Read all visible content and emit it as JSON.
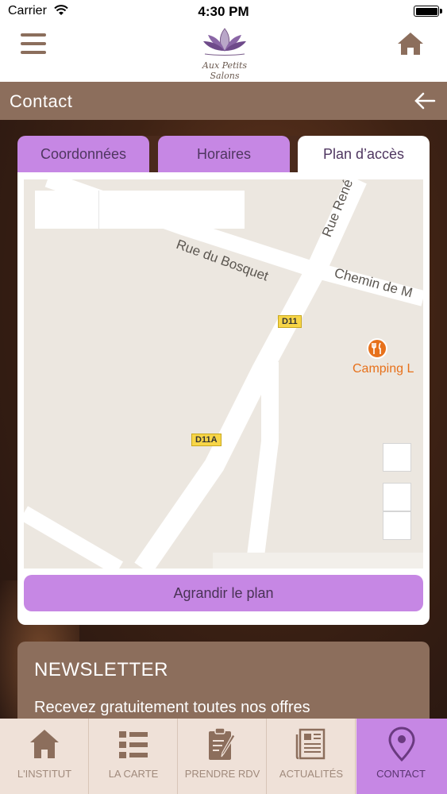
{
  "status_bar": {
    "carrier": "Carrier",
    "time": "4:30 PM"
  },
  "header": {
    "logo_text": "Aux Petits Salons",
    "menu_icon": "hamburger-menu-icon",
    "home_icon": "home-icon"
  },
  "page": {
    "title": "Contact",
    "back_icon": "arrow-left-icon"
  },
  "tabs": [
    {
      "label": "Coordonnées",
      "active": false
    },
    {
      "label": "Horaires",
      "active": false
    },
    {
      "label": "Plan d’accès",
      "active": true
    }
  ],
  "map": {
    "streets": [
      "Rue du Bosquet",
      "Rue René",
      "Chemin de M"
    ],
    "road_badges": [
      "D11",
      "D11A"
    ],
    "poi": {
      "label": "Camping L",
      "icon": "restaurant-icon"
    }
  },
  "enlarge_button": "Agrandir le plan",
  "newsletter": {
    "title": "NEWSLETTER",
    "text": "Recevez gratuitement toutes nos offres"
  },
  "bottom_nav": [
    {
      "label": "L'INSTITUT",
      "icon": "home-icon",
      "active": false
    },
    {
      "label": "LA CARTE",
      "icon": "list-icon",
      "active": false
    },
    {
      "label": "PRENDRE RDV",
      "icon": "clipboard-edit-icon",
      "active": false
    },
    {
      "label": "ACTUALITÉS",
      "icon": "newspaper-icon",
      "active": false
    },
    {
      "label": "CONTACT",
      "icon": "location-pin-icon",
      "active": true
    }
  ],
  "colors": {
    "brand_brown": "#8c6e5c",
    "accent_purple": "#c687e4",
    "nav_bg": "#efe1d8"
  }
}
